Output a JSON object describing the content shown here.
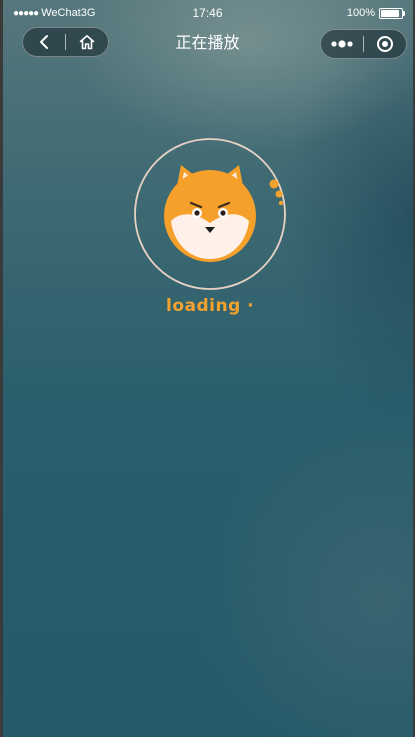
{
  "status_bar": {
    "signal": "●●●●●",
    "carrier": "WeChat3G",
    "time": "17:46",
    "battery": "100%",
    "battery_level": 1.0
  },
  "nav": {
    "back_icon": "chevron-left-icon",
    "home_icon": "home-icon"
  },
  "page": {
    "title": "正在播放"
  },
  "menu": {
    "more_icon": "more-dots-icon",
    "close_icon": "target-circle-icon"
  },
  "loading": {
    "text": "loading ·",
    "mascot": "shiba-dog-face",
    "accent": "#f2a22d",
    "ring_color": "#e8d2c4"
  }
}
